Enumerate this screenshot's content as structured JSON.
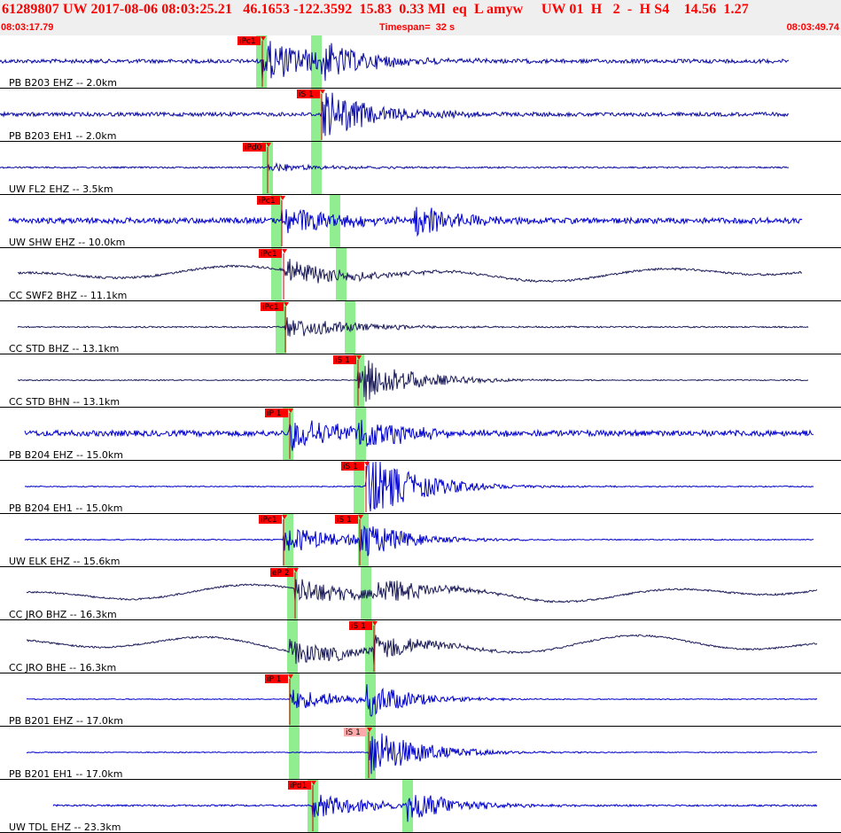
{
  "header": {
    "title": "61289807 UW 2017-08-06 08:03:25.21   46.1653 -122.3592  15.83  0.33 Ml  eq  L amyw     UW 01  H   2  -  H S4    14.56  1.27",
    "start_time": "08:03:17.79",
    "end_time": "08:03:49.74",
    "timespan": "Timespan=  32 s"
  },
  "colors": {
    "header_text": "#ff0000",
    "header_bg": "#efefef",
    "trace_blue": "#0000cc",
    "trace_dark": "#1c1c5a",
    "pick_flag": "#ff0000",
    "pick_flag_light": "#ffaaaa",
    "window_green": "#90ee90"
  },
  "traces": [
    {
      "label": "PB B203 EHZ -- 2.0km",
      "color": "dark_blue",
      "picks": [
        {
          "text": "iPc1",
          "phase": "P"
        }
      ]
    },
    {
      "label": "PB B203 EH1 -- 2.0km",
      "color": "dark_blue",
      "picks": [
        {
          "text": "iS 1",
          "phase": "S"
        }
      ]
    },
    {
      "label": "UW FL2 EHZ -- 3.5km",
      "color": "dark_blue",
      "picks": [
        {
          "text": "iPd0",
          "phase": "P"
        }
      ]
    },
    {
      "label": "UW SHW EHZ -- 10.0km",
      "color": "blue",
      "picks": [
        {
          "text": "iPc1",
          "phase": "P"
        }
      ]
    },
    {
      "label": "CC SWF2 BHZ -- 11.1km",
      "color": "navy",
      "picks": [
        {
          "text": "iPc1",
          "phase": "P"
        }
      ]
    },
    {
      "label": "CC STD BHZ -- 13.1km",
      "color": "navy",
      "picks": [
        {
          "text": "iPc1",
          "phase": "P"
        }
      ]
    },
    {
      "label": "CC STD BHN -- 13.1km",
      "color": "navy",
      "picks": [
        {
          "text": "iS 1",
          "phase": "S"
        }
      ]
    },
    {
      "label": "PB B204 EHZ -- 15.0km",
      "color": "blue",
      "picks": [
        {
          "text": "iP 1",
          "phase": "P"
        }
      ]
    },
    {
      "label": "PB B204 EH1 -- 15.0km",
      "color": "blue",
      "picks": [
        {
          "text": "iS 1",
          "phase": "S"
        }
      ]
    },
    {
      "label": "UW ELK EHZ -- 15.6km",
      "color": "blue",
      "picks": [
        {
          "text": "iPc1",
          "phase": "P"
        },
        {
          "text": "iS 1",
          "phase": "S"
        }
      ]
    },
    {
      "label": "CC JRO BHZ -- 16.3km",
      "color": "navy",
      "picks": [
        {
          "text": "eP 2",
          "phase": "P"
        }
      ]
    },
    {
      "label": "CC JRO BHE -- 16.3km",
      "color": "navy",
      "picks": [
        {
          "text": "iS 1",
          "phase": "S"
        }
      ]
    },
    {
      "label": "PB B201 EHZ -- 17.0km",
      "color": "blue",
      "picks": [
        {
          "text": "iP 1",
          "phase": "P"
        }
      ]
    },
    {
      "label": "PB B201 EH1 -- 17.0km",
      "color": "blue",
      "picks": [
        {
          "text": "iS 1",
          "phase": "S",
          "style": "light"
        }
      ]
    },
    {
      "label": "UW TDL EHZ -- 23.3km",
      "color": "blue",
      "picks": [
        {
          "text": "iPd1",
          "phase": "P"
        }
      ]
    }
  ]
}
